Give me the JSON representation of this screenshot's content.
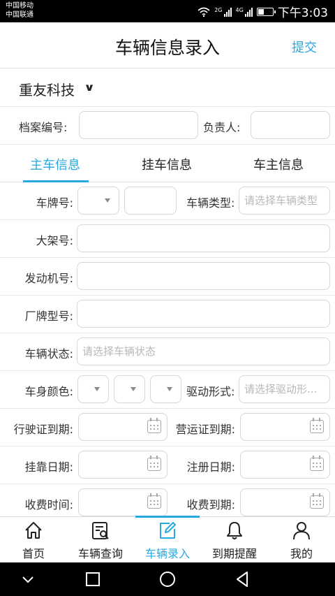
{
  "status_bar": {
    "carrier_1": "中国移动",
    "carrier_2": "中国联通",
    "net_1": "2G",
    "net_2": "4G",
    "time": "下午3:03",
    "battery_level": 0.4
  },
  "header": {
    "title": "车辆信息录入",
    "submit": "提交"
  },
  "company": {
    "name": "重友科技"
  },
  "meta": {
    "archive_no_label": "档案编号:",
    "archive_no_value": "",
    "owner_label": "负责人:",
    "owner_value": ""
  },
  "tabs": [
    {
      "label": "主车信息",
      "active": true
    },
    {
      "label": "挂车信息",
      "active": false
    },
    {
      "label": "车主信息",
      "active": false
    }
  ],
  "form": {
    "plate_label": "车牌号:",
    "plate_prefix_value": "",
    "plate_number_value": "",
    "vehicle_type_label": "车辆类型:",
    "vehicle_type_placeholder": "请选择车辆类型",
    "frame_no_label": "大架号:",
    "frame_no_value": "",
    "engine_no_label": "发动机号:",
    "engine_no_value": "",
    "model_label": "厂牌型号:",
    "model_value": "",
    "status_label": "车辆状态:",
    "status_placeholder": "请选择车辆状态",
    "color_label": "车身颜色:",
    "drive_label": "驱动形式:",
    "drive_placeholder": "请选择驱动形...",
    "license_expiry_label": "行驶证到期:",
    "operation_expiry_label": "营运证到期:",
    "affiliation_date_label": "挂靠日期:",
    "register_date_label": "注册日期:",
    "fee_time_label": "收费时间:",
    "fee_expiry_label": "收费到期:"
  },
  "bottom_nav": [
    {
      "label": "首页",
      "icon": "home-icon",
      "active": false
    },
    {
      "label": "车辆查询",
      "icon": "vehicle-search-icon",
      "active": false
    },
    {
      "label": "车辆录入",
      "icon": "edit-icon",
      "active": true
    },
    {
      "label": "到期提醒",
      "icon": "bell-icon",
      "active": false
    },
    {
      "label": "我的",
      "icon": "user-icon",
      "active": false
    }
  ],
  "colors": {
    "accent": "#29a8e0",
    "border": "#d6d6d6",
    "placeholder": "#b8b8b8"
  }
}
